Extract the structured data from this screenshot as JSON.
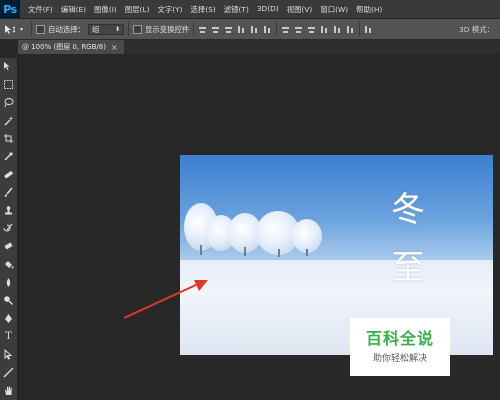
{
  "app": {
    "logo": "Ps"
  },
  "menu": [
    "文件(F)",
    "编辑(E)",
    "图像(I)",
    "图层(L)",
    "文字(Y)",
    "选择(S)",
    "滤镜(T)",
    "3D(D)",
    "视图(V)",
    "窗口(W)",
    "帮助(H)"
  ],
  "options": {
    "auto_select_label": "自动选择：",
    "auto_select_value": "组",
    "show_transform_label": "显示变换控件",
    "mode_3d_label": "3D 模式："
  },
  "tab": {
    "label": "@ 100% (图层 0, RGB/8)",
    "close": "×"
  },
  "image": {
    "title_chars": [
      "冬",
      "至"
    ]
  },
  "watermark": {
    "title": "百科全说",
    "subtitle": "助你轻松解决"
  },
  "colors": {
    "arrow": "#e0362b",
    "watermark_green": "#37b04a",
    "ps_blue": "#31a8ff"
  }
}
